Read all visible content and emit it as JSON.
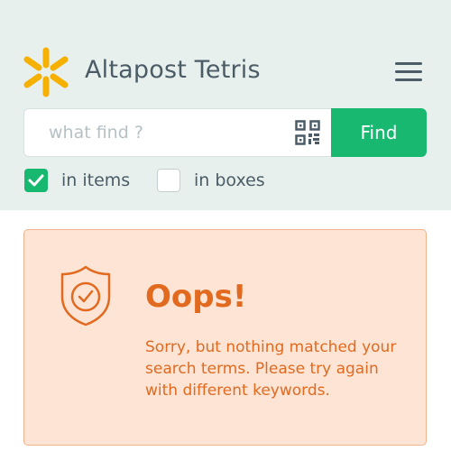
{
  "header": {
    "app_title": "Altapost Tetris",
    "logo_icon": "asterisk-logo-icon",
    "menu_icon": "hamburger-menu-icon",
    "background_color": "#e8f0ee"
  },
  "search": {
    "placeholder": "what find ?",
    "value": "",
    "qr_icon": "qr-code-icon",
    "find_label": "Find",
    "accent_color": "#18b871"
  },
  "filters": [
    {
      "label": "in items",
      "checked": true
    },
    {
      "label": "in boxes",
      "checked": false
    }
  ],
  "error": {
    "icon": "shield-check-icon",
    "title": "Oops!",
    "message": "Sorry, but nothing matched your search terms. Please try again with different keywords.",
    "text_color": "#e26a1f",
    "background_color": "#fde4d5"
  }
}
